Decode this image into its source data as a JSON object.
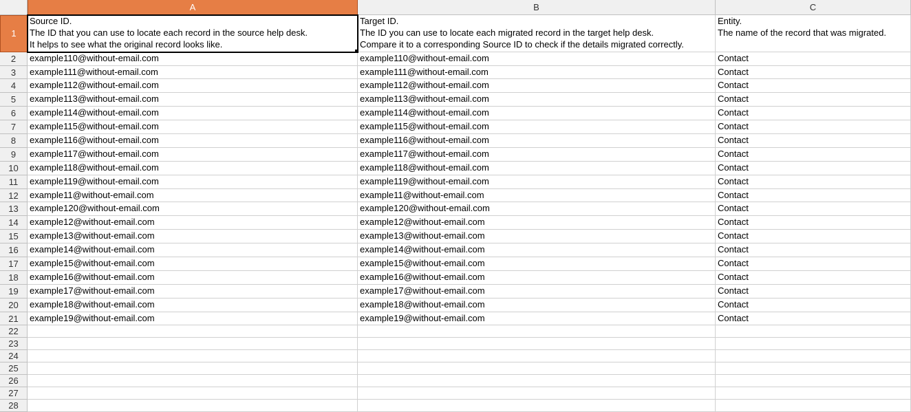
{
  "columns": {
    "corner": "",
    "A": "A",
    "B": "B",
    "C": "C"
  },
  "headerRow": {
    "num": "1",
    "A": "Source ID.\nThe ID that you can use to locate each record in the source help desk.\nIt helps to see what the original record looks like.",
    "B": "Target ID.\nThe ID you can use to locate each migrated record in the target help desk.\nCompare it to a corresponding Source ID to check if the details migrated correctly.",
    "C": "Entity.\nThe name of the record that was migrated."
  },
  "rows": [
    {
      "num": "2",
      "A": "example110@without-email.com",
      "B": "example110@without-email.com",
      "C": "Contact"
    },
    {
      "num": "3",
      "A": "example111@without-email.com",
      "B": "example111@without-email.com",
      "C": "Contact"
    },
    {
      "num": "4",
      "A": "example112@without-email.com",
      "B": "example112@without-email.com",
      "C": "Contact"
    },
    {
      "num": "5",
      "A": "example113@without-email.com",
      "B": "example113@without-email.com",
      "C": "Contact"
    },
    {
      "num": "6",
      "A": "example114@without-email.com",
      "B": "example114@without-email.com",
      "C": "Contact"
    },
    {
      "num": "7",
      "A": "example115@without-email.com",
      "B": "example115@without-email.com",
      "C": "Contact"
    },
    {
      "num": "8",
      "A": "example116@without-email.com",
      "B": "example116@without-email.com",
      "C": "Contact"
    },
    {
      "num": "9",
      "A": "example117@without-email.com",
      "B": "example117@without-email.com",
      "C": "Contact"
    },
    {
      "num": "10",
      "A": "example118@without-email.com",
      "B": "example118@without-email.com",
      "C": "Contact"
    },
    {
      "num": "11",
      "A": "example119@without-email.com",
      "B": "example119@without-email.com",
      "C": "Contact"
    },
    {
      "num": "12",
      "A": "example11@without-email.com",
      "B": "example11@without-email.com",
      "C": "Contact"
    },
    {
      "num": "13",
      "A": "example120@without-email.com",
      "B": "example120@without-email.com",
      "C": "Contact"
    },
    {
      "num": "14",
      "A": "example12@without-email.com",
      "B": "example12@without-email.com",
      "C": "Contact"
    },
    {
      "num": "15",
      "A": "example13@without-email.com",
      "B": "example13@without-email.com",
      "C": "Contact"
    },
    {
      "num": "16",
      "A": "example14@without-email.com",
      "B": "example14@without-email.com",
      "C": "Contact"
    },
    {
      "num": "17",
      "A": "example15@without-email.com",
      "B": "example15@without-email.com",
      "C": "Contact"
    },
    {
      "num": "18",
      "A": "example16@without-email.com",
      "B": "example16@without-email.com",
      "C": "Contact"
    },
    {
      "num": "19",
      "A": "example17@without-email.com",
      "B": "example17@without-email.com",
      "C": "Contact"
    },
    {
      "num": "20",
      "A": "example18@without-email.com",
      "B": "example18@without-email.com",
      "C": "Contact"
    },
    {
      "num": "21",
      "A": "example19@without-email.com",
      "B": "example19@without-email.com",
      "C": "Contact"
    }
  ],
  "emptyRows": [
    "22",
    "23",
    "24",
    "25",
    "26",
    "27",
    "28"
  ]
}
